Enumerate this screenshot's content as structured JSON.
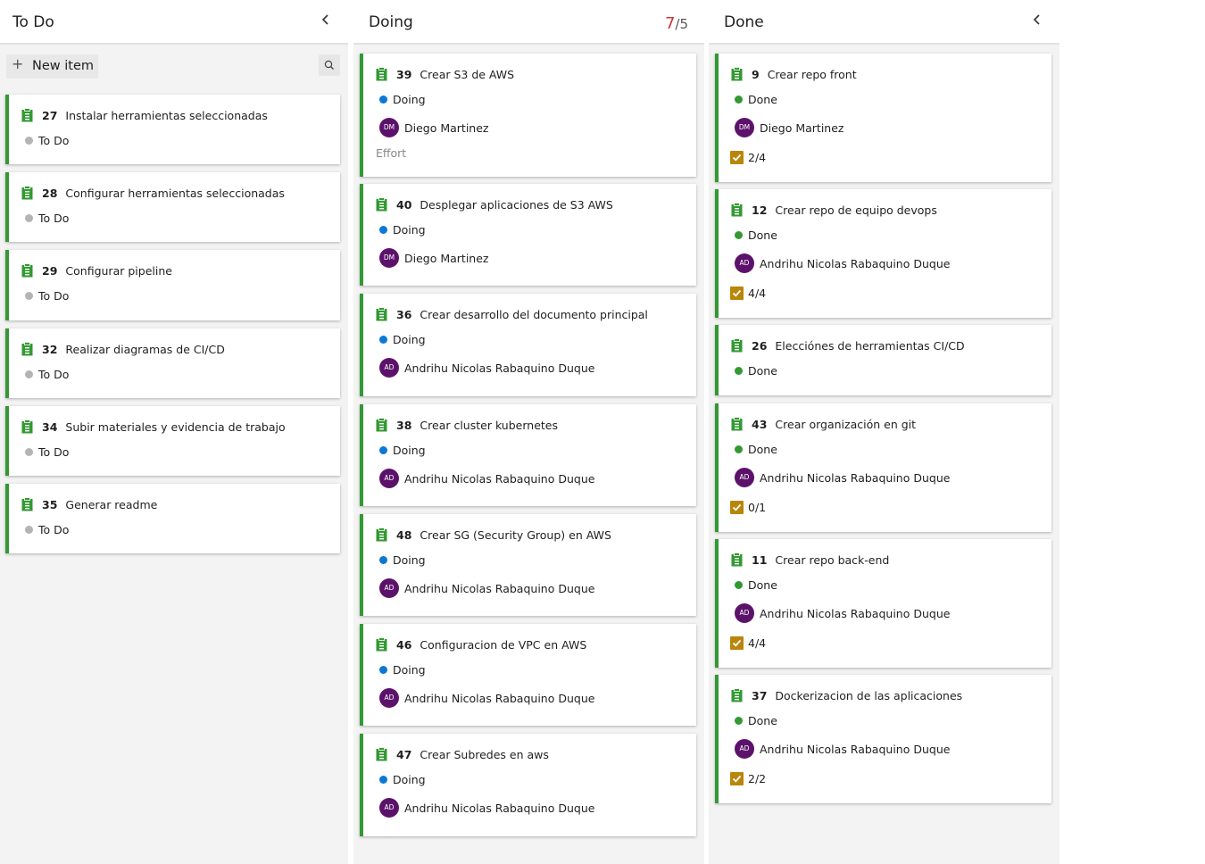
{
  "colors": {
    "todo_dot": "#b4b4b4",
    "doing_dot": "#0a78d4",
    "done_dot": "#339933",
    "card_accent": "#339933",
    "avatar": "#5c126b",
    "wip_over": "#d13438",
    "checklist": "#b8860b"
  },
  "columns": [
    {
      "title": "To Do",
      "new_item": "New item",
      "cards": [
        {
          "id": "27",
          "title": "Instalar herramientas seleccionadas",
          "state": "To Do"
        },
        {
          "id": "28",
          "title": "Configurar herramientas seleccionadas",
          "state": "To Do"
        },
        {
          "id": "29",
          "title": "Configurar pipeline",
          "state": "To Do"
        },
        {
          "id": "32",
          "title": "Realizar diagramas de CI/CD",
          "state": "To Do"
        },
        {
          "id": "34",
          "title": "Subir materiales y evidencia de trabajo",
          "state": "To Do"
        },
        {
          "id": "35",
          "title": "Generar readme",
          "state": "To Do"
        }
      ]
    },
    {
      "title": "Doing",
      "wip_current": "7",
      "wip_limit": "/5",
      "cards": [
        {
          "id": "39",
          "title": "Crear S3 de AWS",
          "state": "Doing",
          "initials": "DM",
          "assignee": "Diego Martinez",
          "effort": "Effort"
        },
        {
          "id": "40",
          "title": "Desplegar aplicaciones de S3 AWS",
          "state": "Doing",
          "initials": "DM",
          "assignee": "Diego Martinez"
        },
        {
          "id": "36",
          "title": "Crear desarrollo del documento principal",
          "state": "Doing",
          "initials": "AD",
          "assignee": "Andrihu Nicolas Rabaquino Duque"
        },
        {
          "id": "38",
          "title": "Crear cluster kubernetes",
          "state": "Doing",
          "initials": "AD",
          "assignee": "Andrihu Nicolas Rabaquino Duque"
        },
        {
          "id": "48",
          "title": "Crear SG (Security Group) en AWS",
          "state": "Doing",
          "initials": "AD",
          "assignee": "Andrihu Nicolas Rabaquino Duque"
        },
        {
          "id": "46",
          "title": "Configuracion de VPC en AWS",
          "state": "Doing",
          "initials": "AD",
          "assignee": "Andrihu Nicolas Rabaquino Duque"
        },
        {
          "id": "47",
          "title": "Crear Subredes en aws",
          "state": "Doing",
          "initials": "AD",
          "assignee": "Andrihu Nicolas Rabaquino Duque"
        }
      ]
    },
    {
      "title": "Done",
      "cards": [
        {
          "id": "9",
          "title": "Crear repo front",
          "state": "Done",
          "initials": "DM",
          "assignee": "Diego Martinez",
          "checklist": "2/4"
        },
        {
          "id": "12",
          "title": "Crear repo de equipo devops",
          "state": "Done",
          "initials": "AD",
          "assignee": "Andrihu Nicolas Rabaquino Duque",
          "checklist": "4/4"
        },
        {
          "id": "26",
          "title": "Elecciónes de herramientas CI/CD",
          "state": "Done"
        },
        {
          "id": "43",
          "title": "Crear organización en git",
          "state": "Done",
          "initials": "AD",
          "assignee": "Andrihu Nicolas Rabaquino Duque",
          "checklist": "0/1"
        },
        {
          "id": "11",
          "title": "Crear repo back-end",
          "state": "Done",
          "initials": "AD",
          "assignee": "Andrihu Nicolas Rabaquino Duque",
          "checklist": "4/4"
        },
        {
          "id": "37",
          "title": "Dockerizacion de las aplicaciones",
          "state": "Done",
          "initials": "AD",
          "assignee": "Andrihu Nicolas Rabaquino Duque",
          "checklist": "2/2"
        }
      ]
    }
  ]
}
